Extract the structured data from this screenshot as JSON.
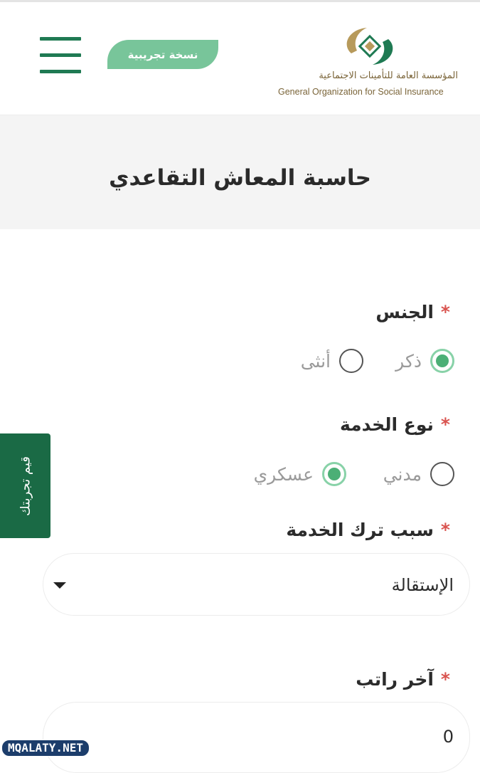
{
  "header": {
    "beta_badge": "نسخة تجريبية",
    "logo_ar": "المؤسسة العامة للتأمينات الاجتماعية",
    "logo_en": "General Organization for Social Insurance",
    "menu_icon": "hamburger-menu-icon"
  },
  "page": {
    "title": "حاسبة المعاش التقاعدي"
  },
  "form": {
    "required_mark": "*",
    "gender": {
      "label": "الجنس",
      "options": [
        {
          "label": "ذكر",
          "checked": true
        },
        {
          "label": "أنثى",
          "checked": false
        }
      ]
    },
    "service_type": {
      "label": "نوع الخدمة",
      "options": [
        {
          "label": "مدني",
          "checked": false
        },
        {
          "label": "عسكري",
          "checked": true
        }
      ]
    },
    "leave_reason": {
      "label": "سبب ترك الخدمة",
      "selected": "الإستقالة"
    },
    "last_salary": {
      "label": "آخر راتب",
      "value": "0"
    }
  },
  "feedback_tab": {
    "label": "قيم تجربتك"
  },
  "watermark": {
    "text": "MQALATY.NET"
  },
  "colors": {
    "brand_green": "#1f7a53",
    "badge_green": "#78c59a",
    "radio_green": "#4caf76",
    "required_red": "#d9534f",
    "logo_gold": "#7a6438"
  }
}
